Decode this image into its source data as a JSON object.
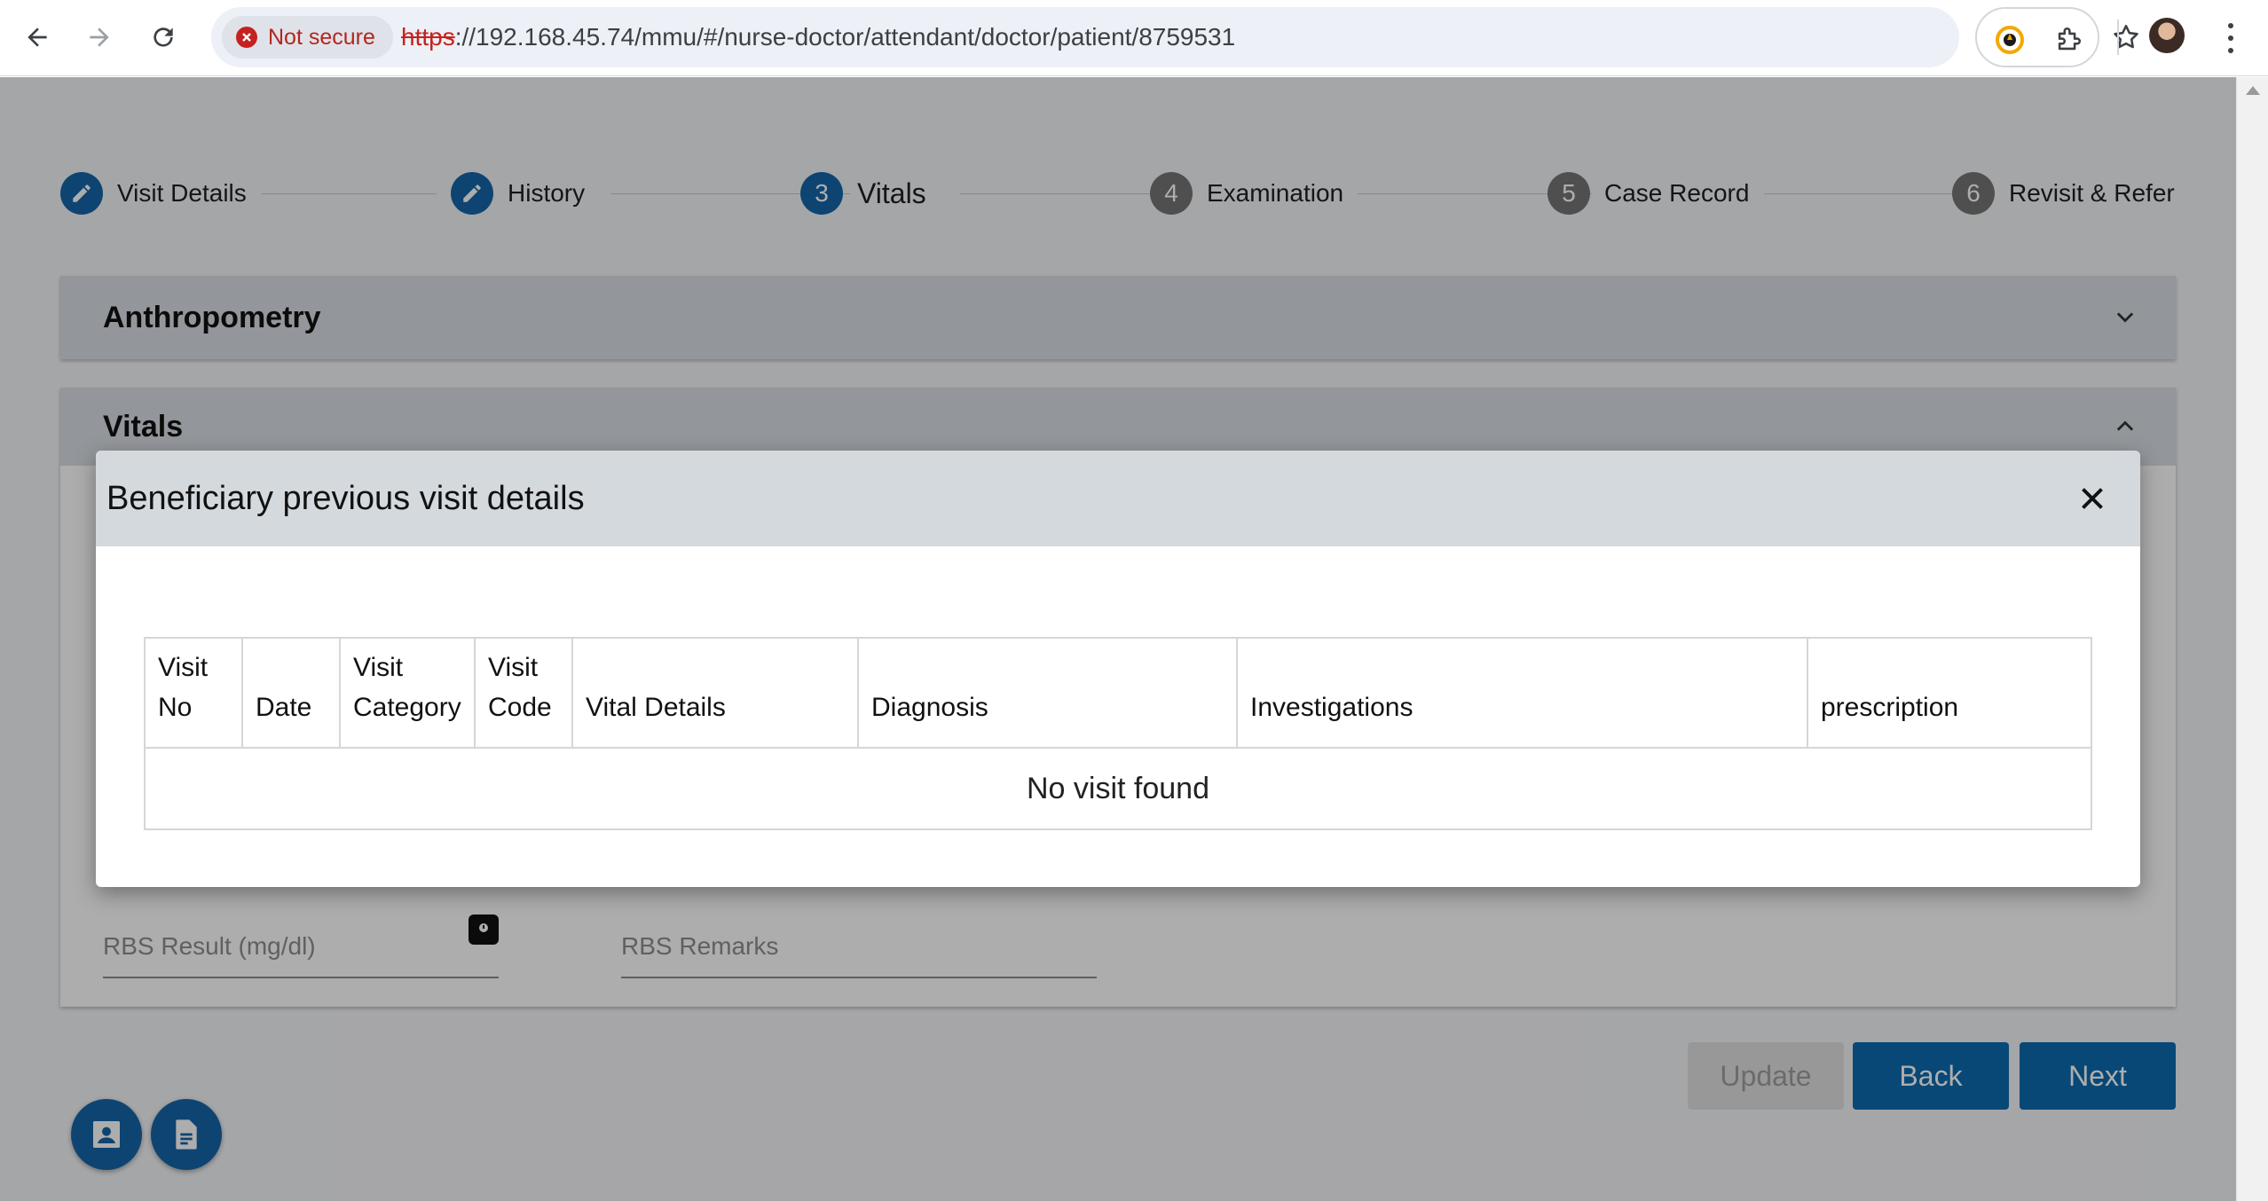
{
  "browser": {
    "security_label": "Not secure",
    "url_scheme": "https",
    "url_rest": "://192.168.45.74/mmu/#/nurse-doctor/attendant/doctor/patient/8759531"
  },
  "stepper": {
    "steps": [
      {
        "number": "",
        "label": "Visit Details",
        "state": "done"
      },
      {
        "number": "",
        "label": "History",
        "state": "done"
      },
      {
        "number": "3",
        "label": "Vitals",
        "state": "active"
      },
      {
        "number": "4",
        "label": "Examination",
        "state": "todo"
      },
      {
        "number": "5",
        "label": "Case Record",
        "state": "todo"
      },
      {
        "number": "6",
        "label": "Revisit & Refer",
        "state": "todo"
      }
    ]
  },
  "panels": {
    "anthropometry_title": "Anthropometry",
    "vitals_title": "Vitals"
  },
  "fields": {
    "rbs_result_label": "RBS Result (mg/dl)",
    "rbs_remarks_label": "RBS Remarks"
  },
  "actions": {
    "update_label": "Update",
    "back_label": "Back",
    "next_label": "Next"
  },
  "dialog": {
    "title": "Beneficiary previous visit details",
    "columns": [
      {
        "line1": "Visit",
        "line2": "No"
      },
      {
        "line1": "",
        "line2": "Date"
      },
      {
        "line1": "Visit",
        "line2": "Category"
      },
      {
        "line1": "Visit",
        "line2": "Code"
      },
      {
        "line1": "",
        "line2": "Vital Details"
      },
      {
        "line1": "",
        "line2": "Diagnosis"
      },
      {
        "line1": "",
        "line2": "Investigations"
      },
      {
        "line1": "",
        "line2": "prescription"
      }
    ],
    "empty_message": "No visit found"
  },
  "colors": {
    "primary": "#1565a8",
    "button_primary": "#0d6bb0",
    "step_todo": "#757575",
    "error": "#c5221f"
  }
}
